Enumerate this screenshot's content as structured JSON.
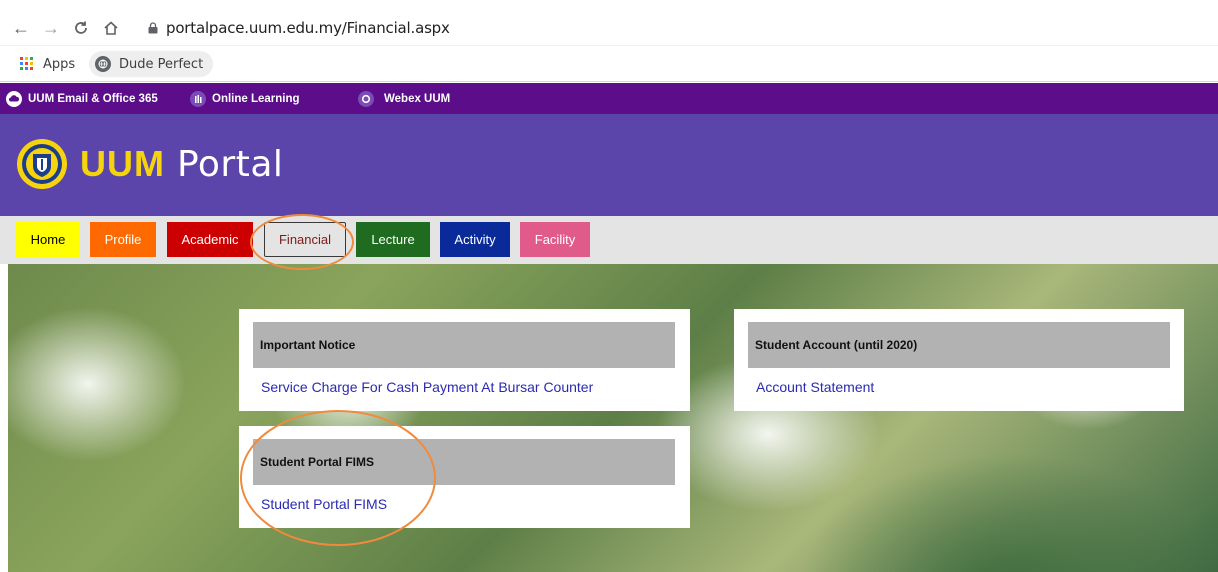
{
  "browser": {
    "url": "portalpace.uum.edu.my/Financial.aspx",
    "bookmarks": [
      {
        "label": "Apps",
        "icon": "apps-grid-icon"
      },
      {
        "label": "Dude Perfect",
        "icon": "globe-icon"
      }
    ]
  },
  "topbar": {
    "links": [
      {
        "label": "UUM Email & Office 365",
        "icon": "cloud-icon"
      },
      {
        "label": "Online Learning",
        "icon": "learning-icon"
      },
      {
        "label": "Webex UUM",
        "icon": "webex-icon"
      }
    ]
  },
  "header": {
    "brand": "UUM",
    "title": "Portal"
  },
  "menu": {
    "items": [
      {
        "label": "Home",
        "color": "#ffff00",
        "text": "#000000"
      },
      {
        "label": "Profile",
        "color": "#ff6a00",
        "text": "#ffffff"
      },
      {
        "label": "Academic",
        "color": "#cc0000",
        "text": "#ffffff"
      },
      {
        "label": "Financial",
        "color": "#e4e4e4",
        "text": "#7a1a1a"
      },
      {
        "label": "Lecture",
        "color": "#1f6b1f",
        "text": "#ffffff"
      },
      {
        "label": "Activity",
        "color": "#0a2a9a",
        "text": "#ffffff"
      },
      {
        "label": "Facility",
        "color": "#e05a8a",
        "text": "#ffffff"
      }
    ]
  },
  "cards": {
    "notice": {
      "title": "Important Notice",
      "link": "Service Charge For Cash Payment At Bursar Counter"
    },
    "account": {
      "title": "Student Account (until 2020)",
      "link": "Account Statement"
    },
    "fims": {
      "title": "Student Portal FIMS",
      "link": "Student Portal FIMS"
    }
  },
  "colors": {
    "topbar": "#5b0d8a",
    "header": "#5b45aa",
    "brand_yellow": "#f5d40e",
    "annotation": "#f08a3c",
    "link": "#2a2ab4"
  }
}
